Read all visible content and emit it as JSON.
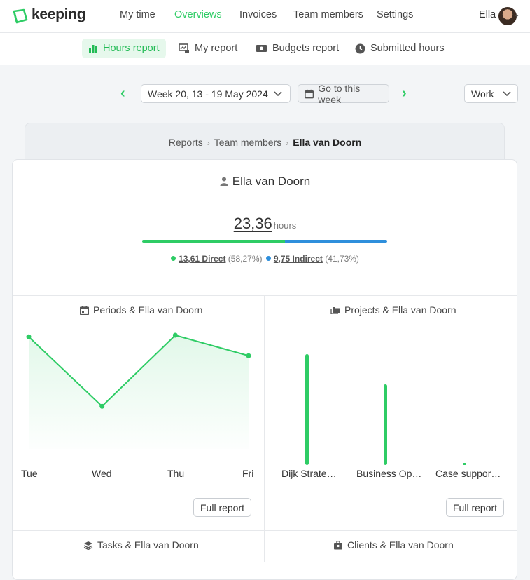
{
  "app": {
    "name": "keeping",
    "brand_color": "#2ecc65"
  },
  "nav": {
    "items": [
      "My time",
      "Overviews",
      "Invoices",
      "Team members",
      "Settings"
    ],
    "active": "Overviews",
    "user": "Ella"
  },
  "subnav": {
    "items": [
      {
        "label": "Hours report",
        "icon": "bar-chart-icon",
        "active": true
      },
      {
        "label": "My report",
        "icon": "chart-monitor-icon",
        "active": false
      },
      {
        "label": "Budgets report",
        "icon": "money-icon",
        "active": false
      },
      {
        "label": "Submitted hours",
        "icon": "clock-icon",
        "active": false
      }
    ]
  },
  "period": {
    "week_label": "Week 20, 13 - 19 May 2024",
    "go_to_week": "Go to this week",
    "filter": "Work"
  },
  "breadcrumb": {
    "items": [
      "Reports",
      "Team members"
    ],
    "current": "Ella van Doorn"
  },
  "summary": {
    "person": "Ella van Doorn",
    "total_hours": "23,36",
    "unit": "hours",
    "direct_value": "13,61 Direct",
    "direct_pct": "(58,27%)",
    "indirect_value": "9,75 Indirect",
    "indirect_pct": "(41,73%)",
    "direct_fraction": 0.5827,
    "direct_color": "#2ecc65",
    "indirect_color": "#2e8fdc"
  },
  "panels": {
    "periods": {
      "title": "Periods & Ella van Doorn",
      "button": "Full report"
    },
    "projects": {
      "title": "Projects & Ella van Doorn",
      "button": "Full report"
    },
    "tasks": {
      "title": "Tasks & Ella van Doorn"
    },
    "clients": {
      "title": "Clients & Ella van Doorn"
    }
  },
  "chart_data": [
    {
      "type": "area",
      "categories": [
        "Tue",
        "Wed",
        "Thu",
        "Fri"
      ],
      "values": [
        7.1,
        2.7,
        7.2,
        5.9
      ],
      "ylim": [
        0,
        8
      ]
    },
    {
      "type": "bar",
      "categories": [
        "Dijk Strate…",
        "Business Op…",
        "Case suppor…"
      ],
      "values": [
        11.0,
        8.0,
        0.2
      ],
      "ylim": [
        0,
        11
      ]
    }
  ]
}
